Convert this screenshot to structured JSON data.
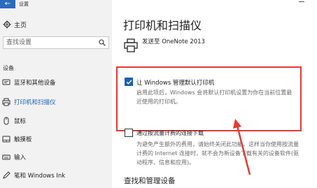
{
  "window": {
    "title": "设置",
    "back_glyph": "←"
  },
  "sidebar": {
    "home_label": "主页",
    "search_placeholder": "查找设置",
    "section_label": "设备",
    "items": [
      {
        "label": "蓝牙和其他设备",
        "icon": "bluetooth-icon",
        "active": false
      },
      {
        "label": "打印机和扫描仪",
        "icon": "printer-icon",
        "active": true
      },
      {
        "label": "鼠标",
        "icon": "mouse-icon",
        "active": false
      },
      {
        "label": "触摸板",
        "icon": "touchpad-icon",
        "active": false
      },
      {
        "label": "输入",
        "icon": "keyboard-icon",
        "active": false
      },
      {
        "label": "笔和 Windows Ink",
        "icon": "pen-icon",
        "active": false
      }
    ]
  },
  "main": {
    "title": "打印机和扫描仪",
    "printer_name": "发送至 OneNote 2013",
    "default_printer": {
      "label": "让 Windows 管理默认打印机",
      "checked": true,
      "description": "启用此项后，Windows 会将默认打印机设置为你在当前位置最近使用的打印机。"
    },
    "metered": {
      "label": "通过按流量计费的连接下载",
      "checked": false,
      "description": "为避免产生额外的费用，请始终关闭此功能，这样当你使用按流量计费的 Internet 连接时，就不会为新设备下载有关的设备软件(驱动程序、信息和应用)。"
    },
    "section2_title": "查找和管理设备"
  },
  "colors": {
    "accent": "#1a5fb4",
    "highlight_border": "#e53935",
    "sidebar_bg": "#f2f2f2"
  }
}
